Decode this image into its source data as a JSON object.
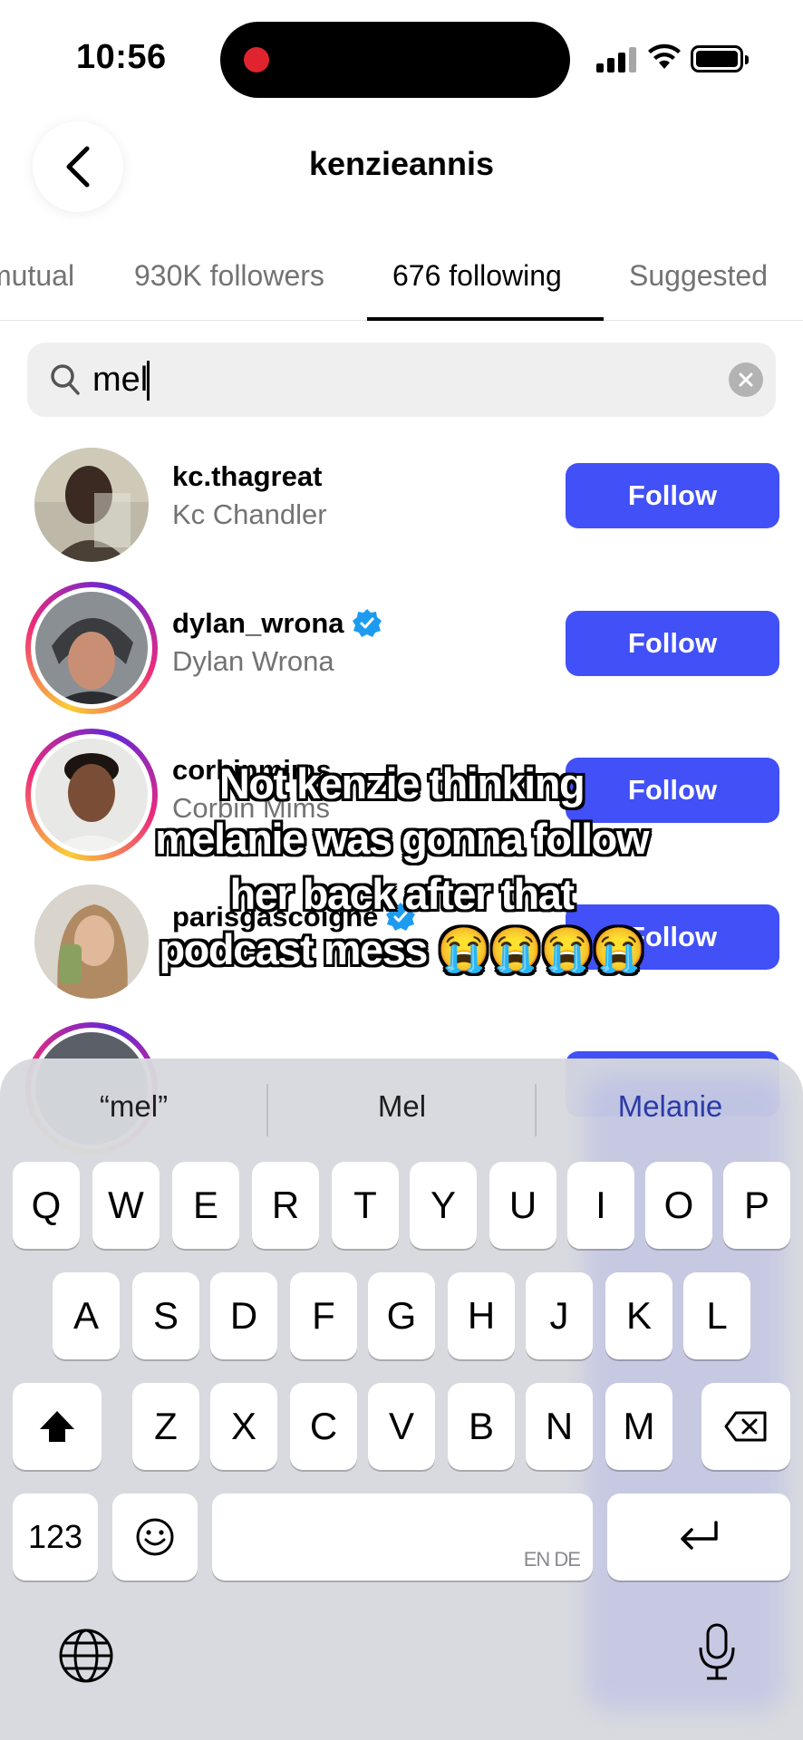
{
  "status_bar": {
    "time": "10:56"
  },
  "header": {
    "title": "kenzieannis"
  },
  "tabs": [
    {
      "label": "mutual"
    },
    {
      "label": "930K followers"
    },
    {
      "label": "676 following"
    },
    {
      "label": "Suggested"
    }
  ],
  "search": {
    "value": "mel"
  },
  "accounts": [
    {
      "username": "kc.thagreat",
      "name": "Kc Chandler",
      "verified": false,
      "button": "Follow"
    },
    {
      "username": "dylan_wrona",
      "name": "Dylan Wrona",
      "verified": true,
      "button": "Follow"
    },
    {
      "username": "corbinmims",
      "name": "Corbin Mims",
      "verified": false,
      "button": "Follow"
    },
    {
      "username": "parisgascoigne",
      "name": "",
      "verified": true,
      "button": "Follow"
    }
  ],
  "caption": {
    "lines": [
      "Not kenzie thinking",
      "melanie was gonna follow",
      "her back after that",
      "podcast mess 😭😭😭😭"
    ]
  },
  "keyboard": {
    "suggestions": [
      "“mel”",
      "Mel",
      "Melanie"
    ],
    "row1": [
      "Q",
      "W",
      "E",
      "R",
      "T",
      "Y",
      "U",
      "I",
      "O",
      "P"
    ],
    "row2": [
      "A",
      "S",
      "D",
      "F",
      "G",
      "H",
      "J",
      "K",
      "L"
    ],
    "row3": [
      "Z",
      "X",
      "C",
      "V",
      "B",
      "N",
      "M"
    ],
    "numbers_key": "123",
    "space_hint": "EN DE"
  }
}
